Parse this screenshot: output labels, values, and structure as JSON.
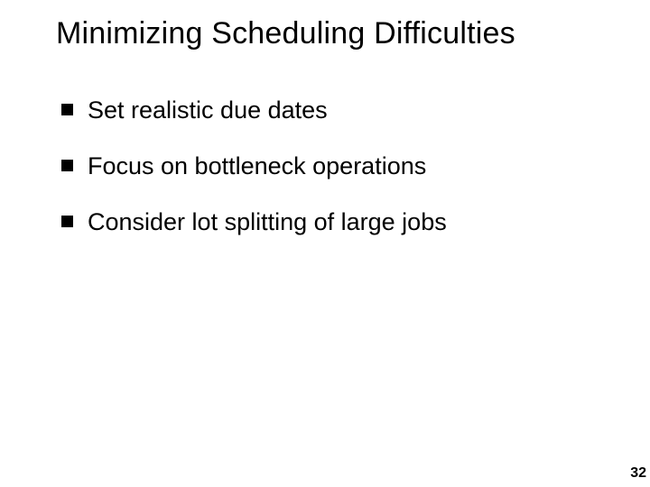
{
  "slide": {
    "title": "Minimizing Scheduling Difficulties",
    "bullets": [
      "Set realistic due dates",
      "Focus on bottleneck operations",
      "Consider lot splitting of large jobs"
    ],
    "page_number": "32"
  }
}
